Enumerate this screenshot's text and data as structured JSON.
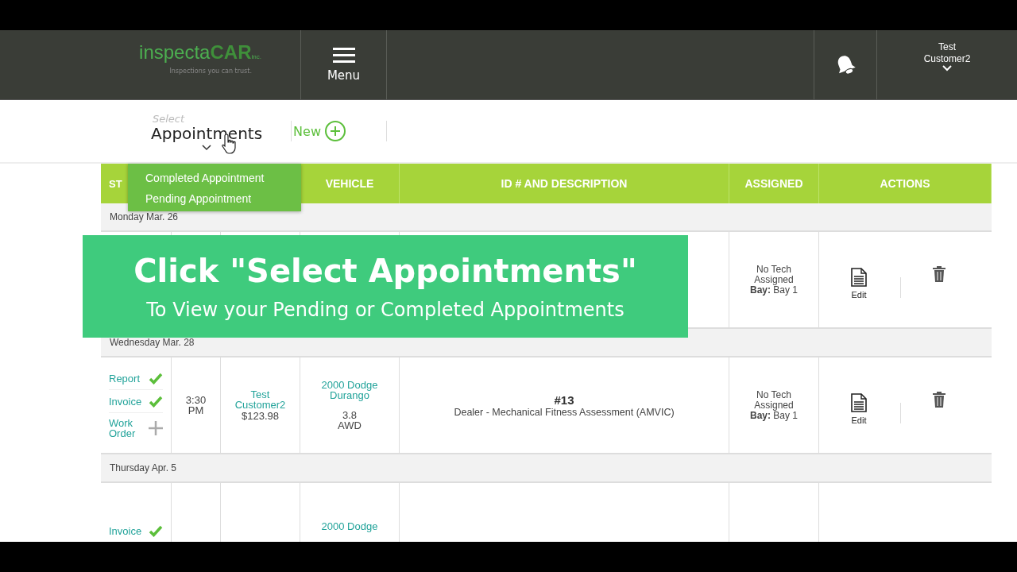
{
  "header": {
    "logo": {
      "name_light": "inspecta",
      "name_bold": "CAR",
      "suffix": "inc.",
      "tagline": "Inspections you can trust."
    },
    "menu_label": "Menu",
    "user": {
      "first": "Test",
      "second": "Customer2"
    }
  },
  "toolbar": {
    "select_hint": "Select",
    "select_label": "Appointments",
    "new_label": "New"
  },
  "dropdown": {
    "items": [
      {
        "label": "Completed Appointment"
      },
      {
        "label": "Pending Appointment"
      }
    ]
  },
  "table": {
    "columns": [
      {
        "label": "ST"
      },
      {},
      {},
      {
        "label": "VEHICLE"
      },
      {
        "label": "ID # AND DESCRIPTION"
      },
      {
        "label": "ASSIGNED"
      },
      {
        "label": "ACTIONS"
      }
    ],
    "groups": [
      {
        "date": "Monday Mar. 26",
        "rows": [
          {
            "status": [],
            "assigned": {
              "line1": "No Tech",
              "line2": "Assigned",
              "bay_label": "Bay:",
              "bay": "Bay 1"
            },
            "edit_label": "Edit"
          }
        ]
      },
      {
        "date": "Wednesday Mar. 28",
        "rows": [
          {
            "status": [
              {
                "label": "Report",
                "done": true
              },
              {
                "label": "Invoice",
                "done": true
              },
              {
                "label": "Work Order",
                "done": false
              }
            ],
            "time": "3:30 PM",
            "customer": "Test Customer2",
            "amount": "$123.98",
            "vehicle": "2000 Dodge Durango",
            "engine": "3.8",
            "drive": "AWD",
            "number": "#13",
            "description": "Dealer - Mechanical Fitness Assessment (AMVIC)",
            "assigned": {
              "line1": "No Tech",
              "line2": "Assigned",
              "bay_label": "Bay:",
              "bay": "Bay 1"
            },
            "edit_label": "Edit"
          }
        ]
      },
      {
        "date": "Thursday Apr. 5",
        "rows": [
          {
            "status": [
              {
                "label": "Invoice",
                "done": true
              }
            ],
            "vehicle": "2000 Dodge"
          }
        ]
      }
    ]
  },
  "banner": {
    "title": "Click \"Select Appointments\"",
    "subtitle": "To View your Pending or Completed Appointments"
  }
}
